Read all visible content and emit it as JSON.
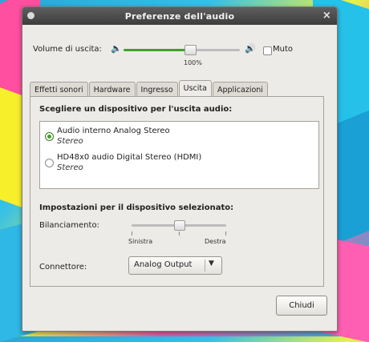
{
  "window": {
    "title": "Preferenze dell'audio"
  },
  "volume": {
    "label": "Volume di uscita:",
    "level": 0.57,
    "percent_label": "100%",
    "mute_label": "Muto",
    "mute_checked": false,
    "low_icon": "speaker-low-icon",
    "high_icon": "speaker-high-icon"
  },
  "tabs": [
    {
      "label": "Effetti sonori",
      "active": false
    },
    {
      "label": "Hardware",
      "active": false
    },
    {
      "label": "Ingresso",
      "active": false
    },
    {
      "label": "Uscita",
      "active": true
    },
    {
      "label": "Applicazioni",
      "active": false
    }
  ],
  "output": {
    "section_title": "Scegliere un dispositivo per l'uscita audio:",
    "devices": [
      {
        "name": "Audio interno Analog Stereo",
        "profile": "Stereo",
        "selected": true
      },
      {
        "name": "HD48x0 audio Digital Stereo (HDMI)",
        "profile": "Stereo",
        "selected": false
      }
    ]
  },
  "settings": {
    "section_title": "Impostazioni per il dispositivo selezionato:",
    "balance_label": "Bilanciamento:",
    "balance_value": 0.5,
    "balance_left": "Sinistra",
    "balance_right": "Destra",
    "connector_label": "Connettore:",
    "connector_value": "Analog Output"
  },
  "buttons": {
    "close_label": "Chiudi"
  },
  "colors": {
    "accent": "#3fa12b",
    "titlebar": "#4a4a4a",
    "window_bg": "#edebe7"
  }
}
